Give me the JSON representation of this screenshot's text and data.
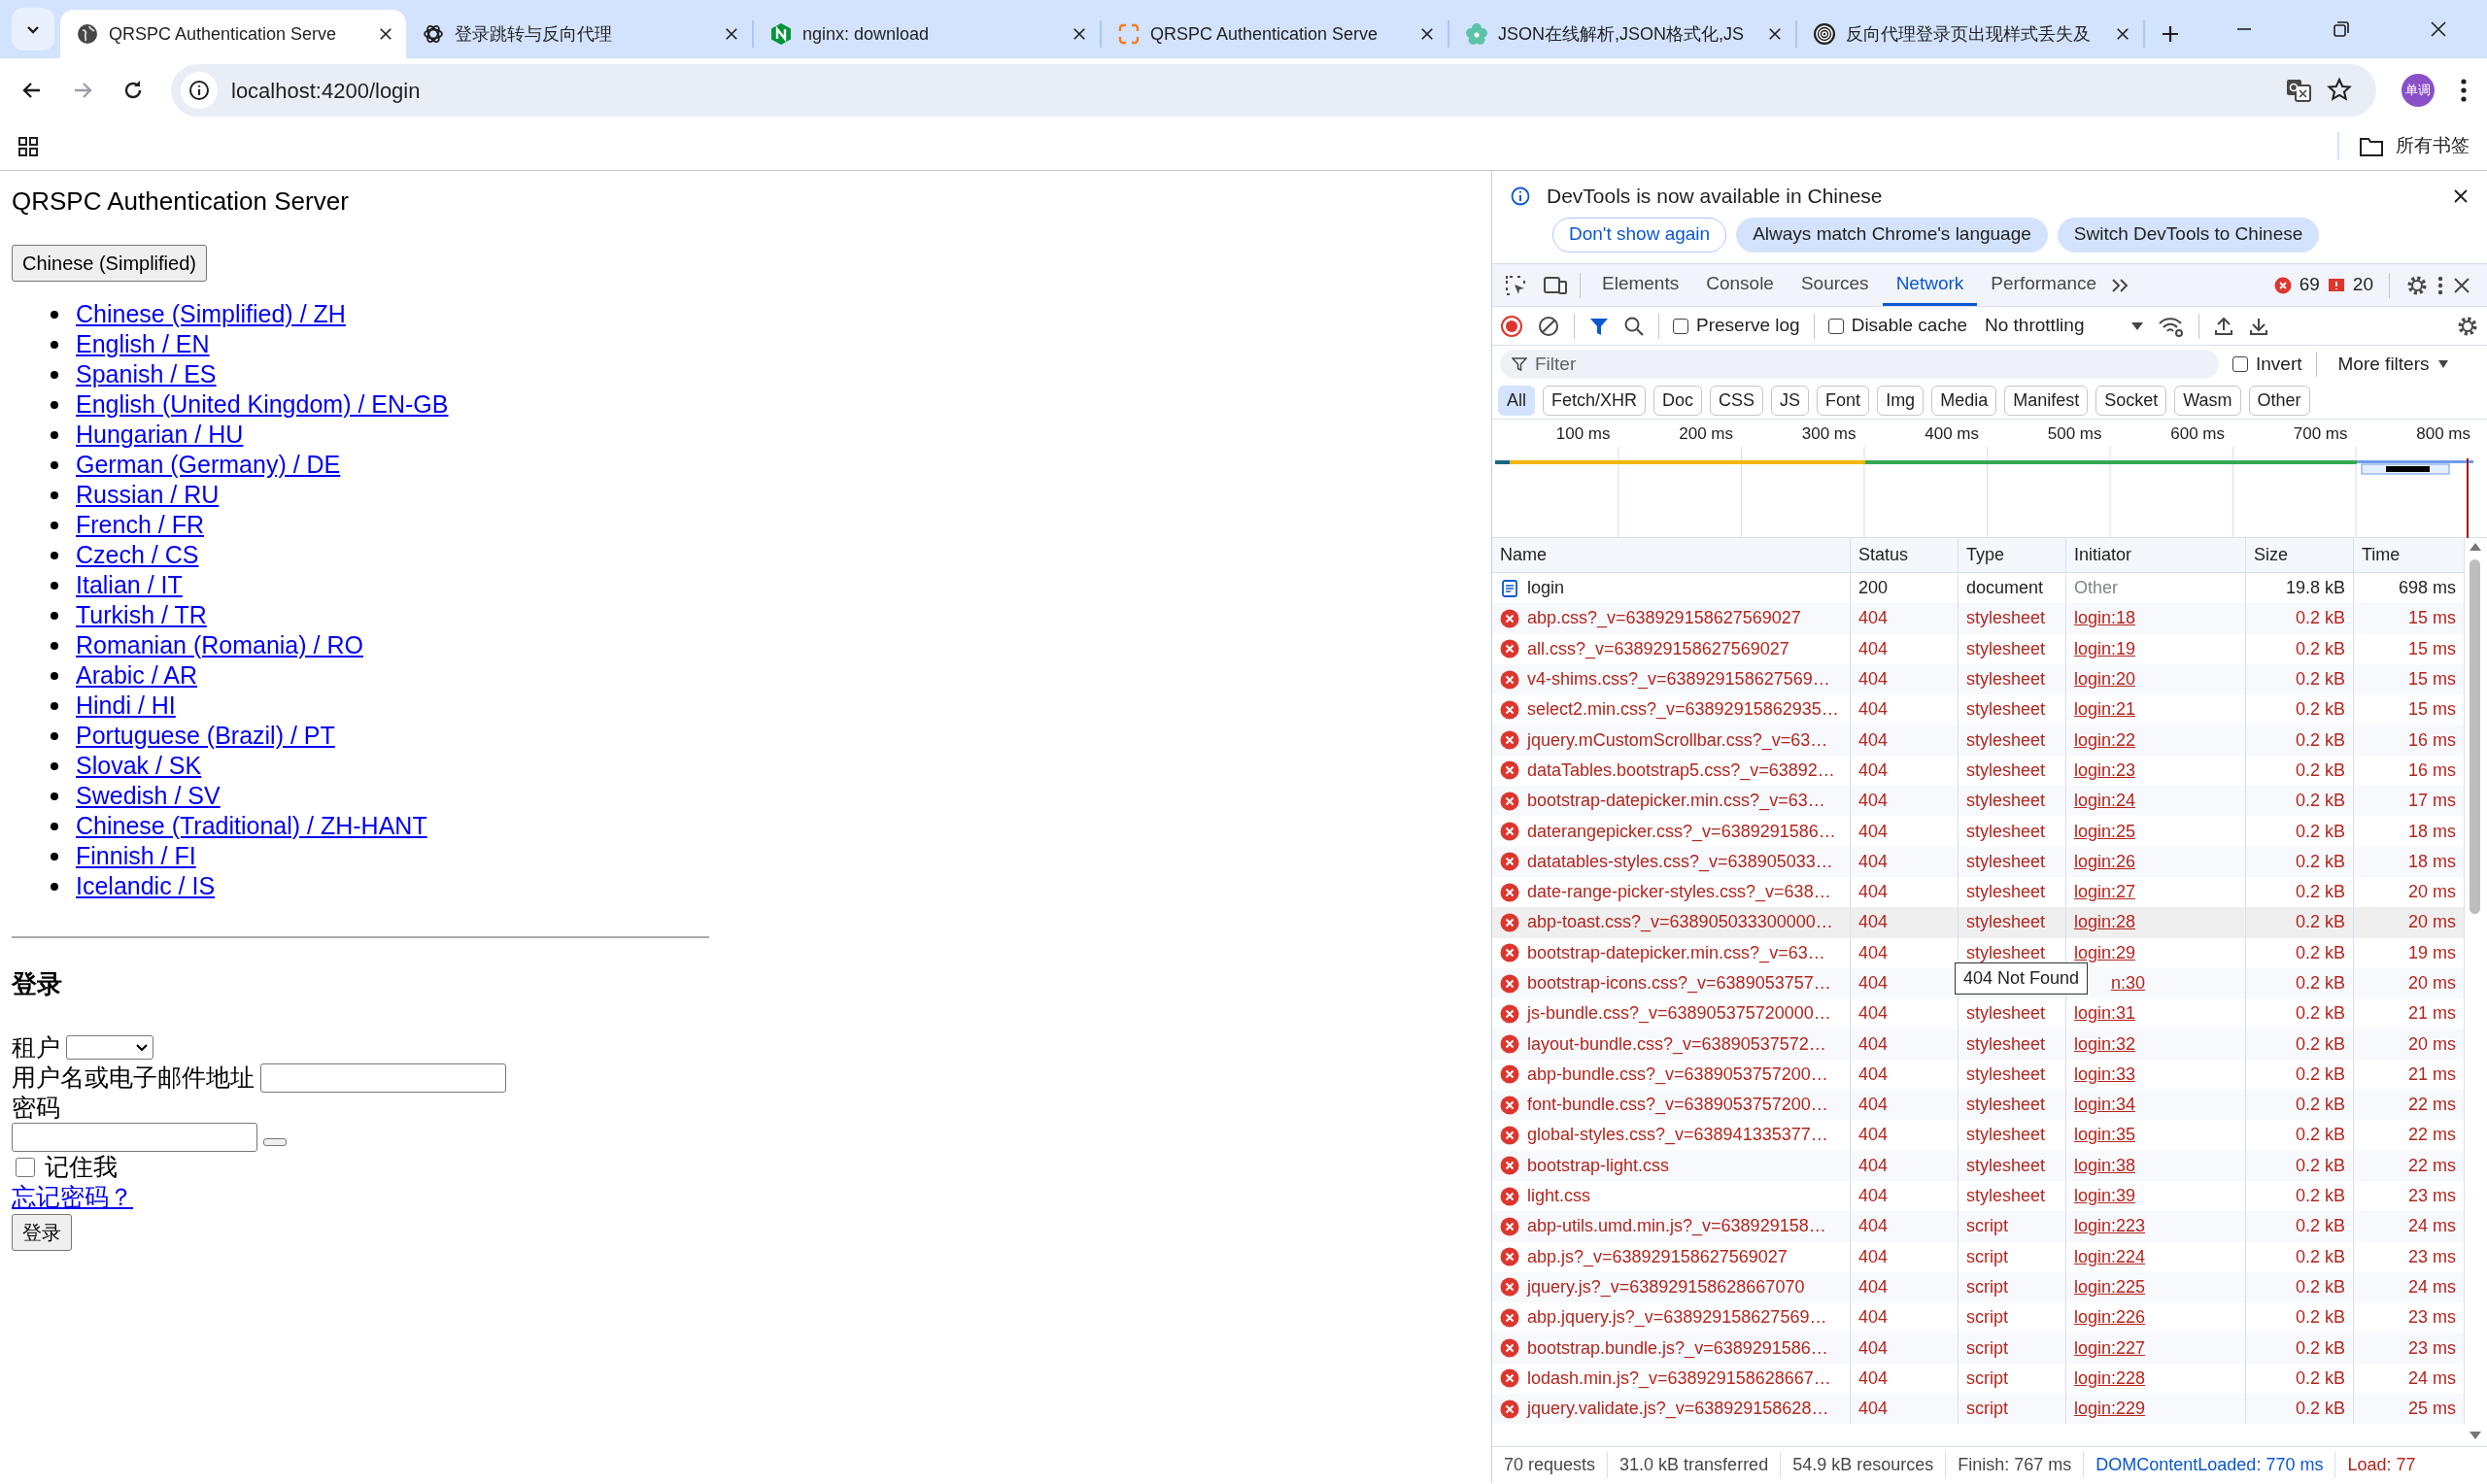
{
  "browser": {
    "tabs": [
      {
        "title": "QRSPC Authentication Serve",
        "selected": true
      },
      {
        "title": "登录跳转与反向代理",
        "selected": false
      },
      {
        "title": "nginx: download",
        "selected": false
      },
      {
        "title": "QRSPC Authentication Serve",
        "selected": false
      },
      {
        "title": "JSON在线解析,JSON格式化,JS",
        "selected": false
      },
      {
        "title": "反向代理登录页出现样式丢失及",
        "selected": false
      }
    ],
    "address": "localhost:4200/login",
    "profile": "单调",
    "bookmarks_folder": "所有书签"
  },
  "page": {
    "title": "QRSPC Authentication Server",
    "language_button": "Chinese (Simplified)",
    "languages": [
      "Chinese (Simplified) / ZH",
      "English / EN",
      "Spanish / ES",
      "English (United Kingdom) / EN-GB",
      "Hungarian / HU",
      "German (Germany) / DE",
      "Russian / RU",
      "French / FR",
      "Czech / CS",
      "Italian / IT",
      "Turkish / TR",
      "Romanian (Romania) / RO",
      "Arabic / AR",
      "Hindi / HI",
      "Portuguese (Brazil) / PT",
      "Slovak / SK",
      "Swedish / SV",
      "Chinese (Traditional) / ZH-HANT",
      "Finnish / FI",
      "Icelandic / IS"
    ],
    "login": {
      "heading": "登录",
      "tenant_label": "租户",
      "username_label": "用户名或电子邮件地址",
      "password_label": "密码",
      "remember_me": {
        "label": "记住我",
        "checked": false
      },
      "forgot_link": "忘记密码？",
      "submit": "登录"
    }
  },
  "devtools": {
    "notice": {
      "text": "DevTools is now available in Chinese",
      "buttons": [
        {
          "label": "Don't show again",
          "kind": "outline"
        },
        {
          "label": "Always match Chrome's language",
          "kind": "filled"
        },
        {
          "label": "Switch DevTools to Chinese",
          "kind": "filled"
        }
      ]
    },
    "tabs": [
      {
        "label": "Elements",
        "selected": false
      },
      {
        "label": "Console",
        "selected": false
      },
      {
        "label": "Sources",
        "selected": false
      },
      {
        "label": "Network",
        "selected": true
      },
      {
        "label": "Performance",
        "selected": false
      }
    ],
    "errors": "69",
    "warnings": "20",
    "toolbar": {
      "preserve_log": {
        "label": "Preserve log",
        "checked": false
      },
      "disable_cache": {
        "label": "Disable cache",
        "checked": false
      },
      "throttling": "No throttling"
    },
    "filter": {
      "placeholder": "Filter",
      "invert": {
        "label": "Invert",
        "checked": false
      },
      "more_filters": "More filters"
    },
    "type_filters": [
      {
        "label": "All",
        "selected": true
      },
      {
        "label": "Fetch/XHR",
        "selected": false
      },
      {
        "label": "Doc",
        "selected": false
      },
      {
        "label": "CSS",
        "selected": false
      },
      {
        "label": "JS",
        "selected": false
      },
      {
        "label": "Font",
        "selected": false
      },
      {
        "label": "Img",
        "selected": false
      },
      {
        "label": "Media",
        "selected": false
      },
      {
        "label": "Manifest",
        "selected": false
      },
      {
        "label": "Socket",
        "selected": false
      },
      {
        "label": "Wasm",
        "selected": false
      },
      {
        "label": "Other",
        "selected": false
      }
    ],
    "overview": {
      "ticks": [
        "100 ms",
        "200 ms",
        "300 ms",
        "400 ms",
        "500 ms",
        "600 ms",
        "700 ms",
        "800 ms"
      ]
    },
    "table": {
      "columns": [
        "Name",
        "Status",
        "Type",
        "Initiator",
        "Size",
        "Time"
      ],
      "rows": [
        {
          "kind": "document",
          "name": "login",
          "status": "200",
          "type": "document",
          "initiator": "Other",
          "size": "19.8 kB",
          "time": "698 ms",
          "highlighted": false
        },
        {
          "kind": "error",
          "name": "abp.css?_v=638929158627569027",
          "status": "404",
          "type": "stylesheet",
          "initiator": "login:18",
          "size": "0.2 kB",
          "time": "15 ms",
          "highlighted": false
        },
        {
          "kind": "error",
          "name": "all.css?_v=638929158627569027",
          "status": "404",
          "type": "stylesheet",
          "initiator": "login:19",
          "size": "0.2 kB",
          "time": "15 ms",
          "highlighted": false
        },
        {
          "kind": "error",
          "name": "v4-shims.css?_v=638929158627569…",
          "status": "404",
          "type": "stylesheet",
          "initiator": "login:20",
          "size": "0.2 kB",
          "time": "15 ms",
          "highlighted": false
        },
        {
          "kind": "error",
          "name": "select2.min.css?_v=63892915862935…",
          "status": "404",
          "type": "stylesheet",
          "initiator": "login:21",
          "size": "0.2 kB",
          "time": "15 ms",
          "highlighted": false
        },
        {
          "kind": "error",
          "name": "jquery.mCustomScrollbar.css?_v=63…",
          "status": "404",
          "type": "stylesheet",
          "initiator": "login:22",
          "size": "0.2 kB",
          "time": "16 ms",
          "highlighted": false
        },
        {
          "kind": "error",
          "name": "dataTables.bootstrap5.css?_v=63892…",
          "status": "404",
          "type": "stylesheet",
          "initiator": "login:23",
          "size": "0.2 kB",
          "time": "16 ms",
          "highlighted": false
        },
        {
          "kind": "error",
          "name": "bootstrap-datepicker.min.css?_v=63…",
          "status": "404",
          "type": "stylesheet",
          "initiator": "login:24",
          "size": "0.2 kB",
          "time": "17 ms",
          "highlighted": false
        },
        {
          "kind": "error",
          "name": "daterangepicker.css?_v=6389291586…",
          "status": "404",
          "type": "stylesheet",
          "initiator": "login:25",
          "size": "0.2 kB",
          "time": "18 ms",
          "highlighted": false
        },
        {
          "kind": "error",
          "name": "datatables-styles.css?_v=638905033…",
          "status": "404",
          "type": "stylesheet",
          "initiator": "login:26",
          "size": "0.2 kB",
          "time": "18 ms",
          "highlighted": false
        },
        {
          "kind": "error",
          "name": "date-range-picker-styles.css?_v=638…",
          "status": "404",
          "type": "stylesheet",
          "initiator": "login:27",
          "size": "0.2 kB",
          "time": "20 ms",
          "highlighted": false
        },
        {
          "kind": "error",
          "name": "abp-toast.css?_v=638905033300000…",
          "status": "404",
          "type": "stylesheet",
          "initiator": "login:28",
          "size": "0.2 kB",
          "time": "20 ms",
          "highlighted": true
        },
        {
          "kind": "error",
          "name": "bootstrap-datepicker.min.css?_v=63…",
          "status": "404",
          "type": "stylesheet",
          "initiator": "login:29",
          "size": "0.2 kB",
          "time": "19 ms",
          "highlighted": false
        },
        {
          "kind": "error",
          "name": "bootstrap-icons.css?_v=6389053757…",
          "status": "404",
          "tooltip": "404 Not Found",
          "initiator": "n:30",
          "size": "0.2 kB",
          "time": "20 ms",
          "highlighted": false
        },
        {
          "kind": "error",
          "name": "js-bundle.css?_v=638905375720000…",
          "status": "404",
          "type": "stylesheet",
          "initiator": "login:31",
          "size": "0.2 kB",
          "time": "21 ms",
          "highlighted": false
        },
        {
          "kind": "error",
          "name": "layout-bundle.css?_v=63890537572…",
          "status": "404",
          "type": "stylesheet",
          "initiator": "login:32",
          "size": "0.2 kB",
          "time": "20 ms",
          "highlighted": false
        },
        {
          "kind": "error",
          "name": "abp-bundle.css?_v=6389053757200…",
          "status": "404",
          "type": "stylesheet",
          "initiator": "login:33",
          "size": "0.2 kB",
          "time": "21 ms",
          "highlighted": false
        },
        {
          "kind": "error",
          "name": "font-bundle.css?_v=6389053757200…",
          "status": "404",
          "type": "stylesheet",
          "initiator": "login:34",
          "size": "0.2 kB",
          "time": "22 ms",
          "highlighted": false
        },
        {
          "kind": "error",
          "name": "global-styles.css?_v=638941335377…",
          "status": "404",
          "type": "stylesheet",
          "initiator": "login:35",
          "size": "0.2 kB",
          "time": "22 ms",
          "highlighted": false
        },
        {
          "kind": "error",
          "name": "bootstrap-light.css",
          "status": "404",
          "type": "stylesheet",
          "initiator": "login:38",
          "size": "0.2 kB",
          "time": "22 ms",
          "highlighted": false
        },
        {
          "kind": "error",
          "name": "light.css",
          "status": "404",
          "type": "stylesheet",
          "initiator": "login:39",
          "size": "0.2 kB",
          "time": "23 ms",
          "highlighted": false
        },
        {
          "kind": "error",
          "name": "abp-utils.umd.min.js?_v=638929158…",
          "status": "404",
          "type": "script",
          "initiator": "login:223",
          "size": "0.2 kB",
          "time": "24 ms",
          "highlighted": false
        },
        {
          "kind": "error",
          "name": "abp.js?_v=638929158627569027",
          "status": "404",
          "type": "script",
          "initiator": "login:224",
          "size": "0.2 kB",
          "time": "23 ms",
          "highlighted": false
        },
        {
          "kind": "error",
          "name": "jquery.js?_v=638929158628667070",
          "status": "404",
          "type": "script",
          "initiator": "login:225",
          "size": "0.2 kB",
          "time": "24 ms",
          "highlighted": false
        },
        {
          "kind": "error",
          "name": "abp.jquery.js?_v=638929158627569…",
          "status": "404",
          "type": "script",
          "initiator": "login:226",
          "size": "0.2 kB",
          "time": "23 ms",
          "highlighted": false
        },
        {
          "kind": "error",
          "name": "bootstrap.bundle.js?_v=6389291586…",
          "status": "404",
          "type": "script",
          "initiator": "login:227",
          "size": "0.2 kB",
          "time": "23 ms",
          "highlighted": false
        },
        {
          "kind": "error",
          "name": "lodash.min.js?_v=638929158628667…",
          "status": "404",
          "type": "script",
          "initiator": "login:228",
          "size": "0.2 kB",
          "time": "24 ms",
          "highlighted": false
        },
        {
          "kind": "error",
          "name": "jquery.validate.js?_v=638929158628…",
          "status": "404",
          "type": "script",
          "initiator": "login:229",
          "size": "0.2 kB",
          "time": "25 ms",
          "highlighted": false
        }
      ]
    },
    "status_bar": [
      {
        "text": "70 requests",
        "kind": "plain"
      },
      {
        "text": "31.0 kB transferred",
        "kind": "plain"
      },
      {
        "text": "54.9 kB resources",
        "kind": "plain"
      },
      {
        "text": "Finish: 767 ms",
        "kind": "plain"
      },
      {
        "text": "DOMContentLoaded: 770 ms",
        "kind": "dom"
      },
      {
        "text": "Load: 77",
        "kind": "load"
      }
    ]
  }
}
